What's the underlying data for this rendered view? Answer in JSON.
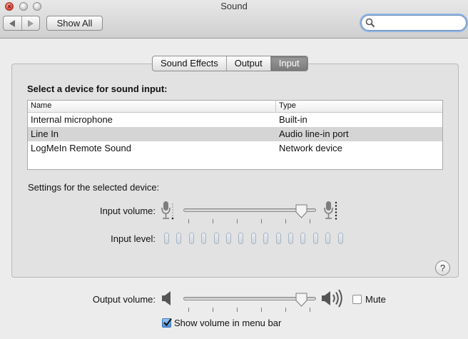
{
  "window": {
    "title": "Sound",
    "close_glyph": "×"
  },
  "toolbar": {
    "show_all_label": "Show All",
    "search_placeholder": ""
  },
  "tabs": [
    {
      "label": "Sound Effects",
      "active": false
    },
    {
      "label": "Output",
      "active": false
    },
    {
      "label": "Input",
      "active": true
    }
  ],
  "input_panel": {
    "heading": "Select a device for sound input:",
    "columns": {
      "name": "Name",
      "type": "Type"
    },
    "devices": [
      {
        "name": "Internal microphone",
        "type": "Built-in",
        "selected": false
      },
      {
        "name": "Line In",
        "type": "Audio line-in port",
        "selected": true
      },
      {
        "name": "LogMeIn Remote Sound",
        "type": "Network device",
        "selected": false
      }
    ],
    "settings_heading": "Settings for the selected device:",
    "input_volume_label": "Input volume:",
    "input_volume_level": 0.88,
    "input_level_label": "Input level:",
    "input_level_segments": 15,
    "input_level_active": 0
  },
  "output": {
    "volume_label": "Output volume:",
    "volume_level": 0.88,
    "mute_label": "Mute",
    "mute_checked": false,
    "show_in_menu_bar_label": "Show volume in menu bar",
    "show_in_menu_bar_checked": true
  },
  "help_glyph": "?",
  "icons": {
    "back": "chevron-left-icon",
    "forward": "chevron-right-icon",
    "search": "search-icon",
    "mic_low": "microphone-low-icon",
    "mic_high": "microphone-high-icon",
    "speaker_low": "speaker-low-icon",
    "speaker_high": "speaker-high-icon",
    "check": "checkmark-icon"
  },
  "colors": {
    "selected_row": "#d5d5d5",
    "active_tab": "#8a8a8a",
    "search_focus": "#8fb5e5",
    "checkbox_checked": "#4a8ed8"
  }
}
